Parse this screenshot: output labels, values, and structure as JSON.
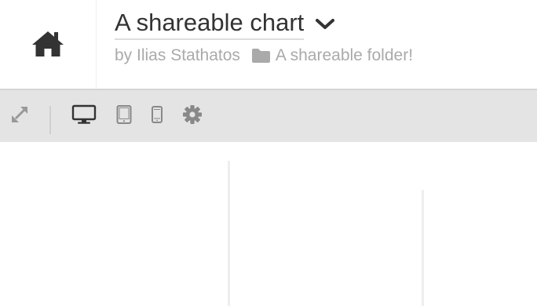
{
  "header": {
    "home_icon": "home-icon",
    "title": "A shareable chart",
    "title_menu_icon": "chevron-down-icon",
    "byline_author": "by Ilias Stathatos",
    "folder_icon": "folder-icon",
    "folder_name": "A shareable folder!"
  },
  "toolbar": {
    "items": [
      {
        "icon": "expand-icon"
      },
      {
        "icon": "desktop-icon",
        "active": true
      },
      {
        "icon": "tablet-icon"
      },
      {
        "icon": "phone-icon"
      },
      {
        "icon": "gear-icon"
      }
    ]
  },
  "colors": {
    "title": "#333333",
    "byline": "#aaaaaa",
    "toolbar_bg": "#e4e4e4",
    "icon_active": "#333333",
    "icon_muted": "#888888"
  }
}
